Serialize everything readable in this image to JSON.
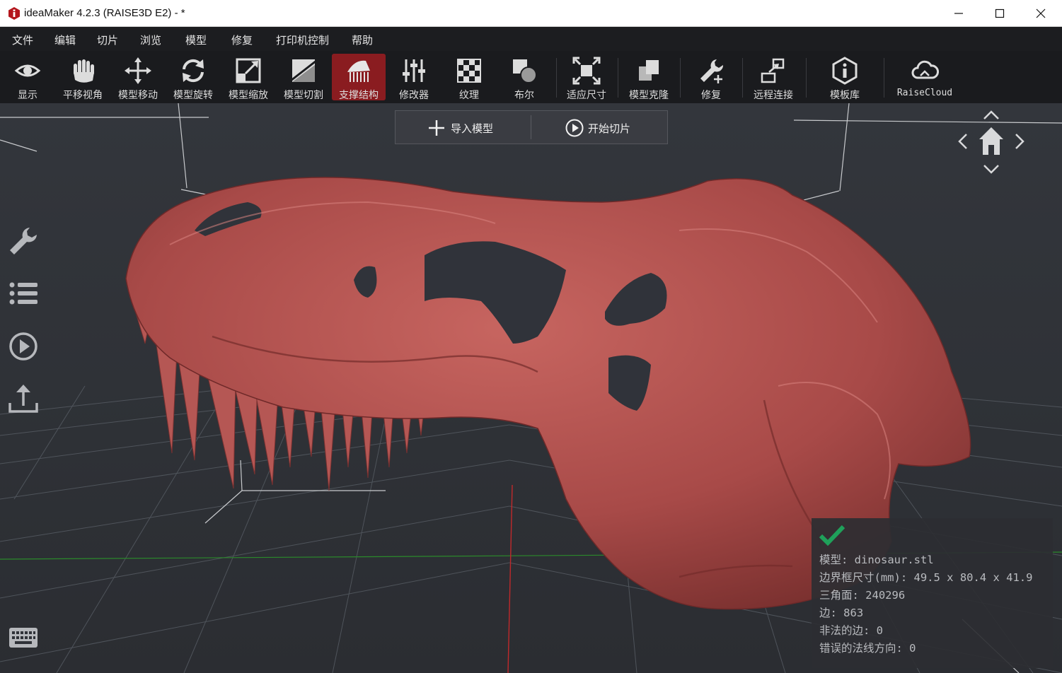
{
  "window": {
    "title": "ideaMaker 4.2.3 (RAISE3D E2) - *",
    "controls": [
      "minimize-icon",
      "maximize-icon",
      "close-icon"
    ]
  },
  "menu": {
    "items": [
      "文件",
      "编辑",
      "切片",
      "浏览",
      "模型",
      "修复",
      "打印机控制",
      "帮助"
    ]
  },
  "toolbar": {
    "active_index": 6,
    "active_color": "#8a1c20",
    "tools": [
      {
        "label": "显示",
        "icon": "eye-icon"
      },
      {
        "label": "平移视角",
        "icon": "hand-pan-icon"
      },
      {
        "label": "模型移动",
        "icon": "move-arrows-icon"
      },
      {
        "label": "模型旋转",
        "icon": "rotate-icon"
      },
      {
        "label": "模型缩放",
        "icon": "scale-icon"
      },
      {
        "label": "模型切割",
        "icon": "cut-icon"
      },
      {
        "label": "支撑结构",
        "icon": "support-structure-icon"
      },
      {
        "label": "修改器",
        "icon": "sliders-icon"
      },
      {
        "label": "纹理",
        "icon": "checker-texture-icon"
      },
      {
        "label": "布尔",
        "icon": "boolean-icon"
      },
      {
        "label": "适应尺寸",
        "icon": "fit-size-icon"
      },
      {
        "label": "模型克隆",
        "icon": "clone-icon"
      },
      {
        "label": "修复",
        "icon": "wrench-repair-icon"
      },
      {
        "label": "远程连接",
        "icon": "remote-connect-icon"
      },
      {
        "label": "模板库",
        "icon": "info-template-icon"
      },
      {
        "label": "RaiseCloud",
        "icon": "cloud-icon"
      }
    ]
  },
  "viewport": {
    "buttons": {
      "import_label": "导入模型",
      "slice_label": "开始切片"
    },
    "side_tools": [
      "wrench-icon",
      "list-icon",
      "play-icon",
      "upload-icon"
    ],
    "keyboard_icon": "keyboard-icon",
    "model_color": "#a84a48",
    "nav_cube_icons": [
      "chevron-up-icon",
      "chevron-left-icon",
      "home-icon",
      "chevron-right-icon",
      "chevron-down-icon"
    ]
  },
  "info": {
    "status_icon": "check-icon",
    "status_color": "#1fa05a",
    "model": "模型: dinosaur.stl",
    "bbox": "边界框尺寸(mm): 49.5 x 80.4 x 41.9",
    "triangles": "三角面: 240296",
    "edges": "边: 863",
    "illegal_edges": "非法的边: 0",
    "bad_normals": "错误的法线方向: 0"
  }
}
